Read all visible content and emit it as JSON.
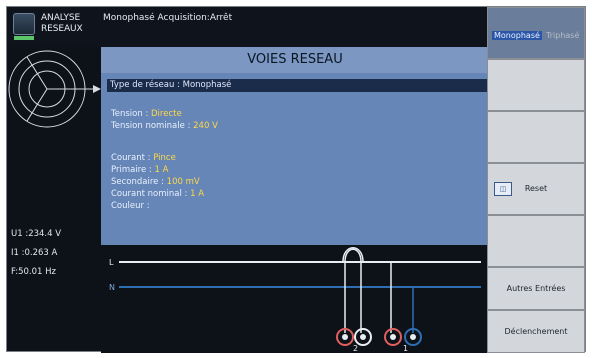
{
  "top_bar": {
    "app_title_line1": "ANALYSE",
    "app_title_line2": "RESEAUX",
    "status_text": "Monophasé Acquisition:Arrêt"
  },
  "center": {
    "title": "VOIES RESEAU",
    "network_type": "Type de réseau : Monophasé",
    "lines": [
      {
        "label": "Tension :",
        "value": "Directe"
      },
      {
        "label": "Tension nominale :",
        "value": "240 V"
      },
      {
        "label": "Courant :",
        "value": "Pince"
      },
      {
        "label": "Primaire :",
        "value": "1 A"
      },
      {
        "label": "Secondaire :",
        "value": "100 mV"
      },
      {
        "label": "Courant nominal :",
        "value": "1 A"
      },
      {
        "label": "Couleur :",
        "value": ""
      }
    ]
  },
  "left": {
    "u1": "U1 :234.4 V",
    "i1": "I1 :0.263 A",
    "freq": "F:50.01 Hz"
  },
  "diagram": {
    "line_labels": [
      "L",
      "N"
    ],
    "ct_labels": [
      "2",
      "1"
    ]
  },
  "right_menu": {
    "monophase": "Monophasé",
    "monophase_faded": "Triphasé",
    "reset": "Reset",
    "autres_entrees": "Autres Entrées",
    "declenchement": "Déclenchement"
  },
  "colors": {
    "accent_blue": "#2b56a8",
    "panel_blue": "#6586b6",
    "value_yellow": "#ffd84a",
    "neutral_line": "#2e6fb3",
    "phase_line": "#e9edf2"
  }
}
